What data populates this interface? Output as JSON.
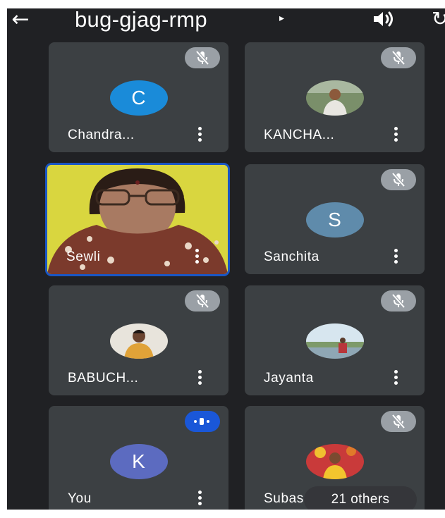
{
  "header": {
    "back_icon": "arrow-left-icon",
    "meeting_code": "bug-gjag-rmp",
    "speaker_icon": "speaker-icon",
    "rotate_icon": "rotate-camera-icon"
  },
  "participants": [
    {
      "name": "Chandra...",
      "avatar_letter": "C",
      "avatar_color": "#1a8bd9",
      "muted": true
    },
    {
      "name": "KANCHA...",
      "avatar_type": "photo",
      "muted": true
    },
    {
      "name": "Sewli",
      "avatar_type": "video",
      "muted": false,
      "active_speaker": true
    },
    {
      "name": "Sanchita",
      "avatar_letter": "S",
      "avatar_color": "#5f8bab",
      "muted": true
    },
    {
      "name": "BABUCH...",
      "avatar_type": "photo",
      "muted": true
    },
    {
      "name": "Jayanta",
      "avatar_type": "photo",
      "muted": true
    },
    {
      "name": "You",
      "avatar_letter": "K",
      "avatar_color": "#5c6bc0",
      "muted": false,
      "speaking": true
    },
    {
      "name": "Subas",
      "avatar_type": "photo",
      "muted": true
    }
  ],
  "others_badge": "21 others",
  "colors": {
    "background": "#202124",
    "tile": "#3c4043",
    "active_border": "#1a56c4",
    "mute_pill": "#9aa0a6",
    "speaking_pill": "#1a57d8"
  }
}
